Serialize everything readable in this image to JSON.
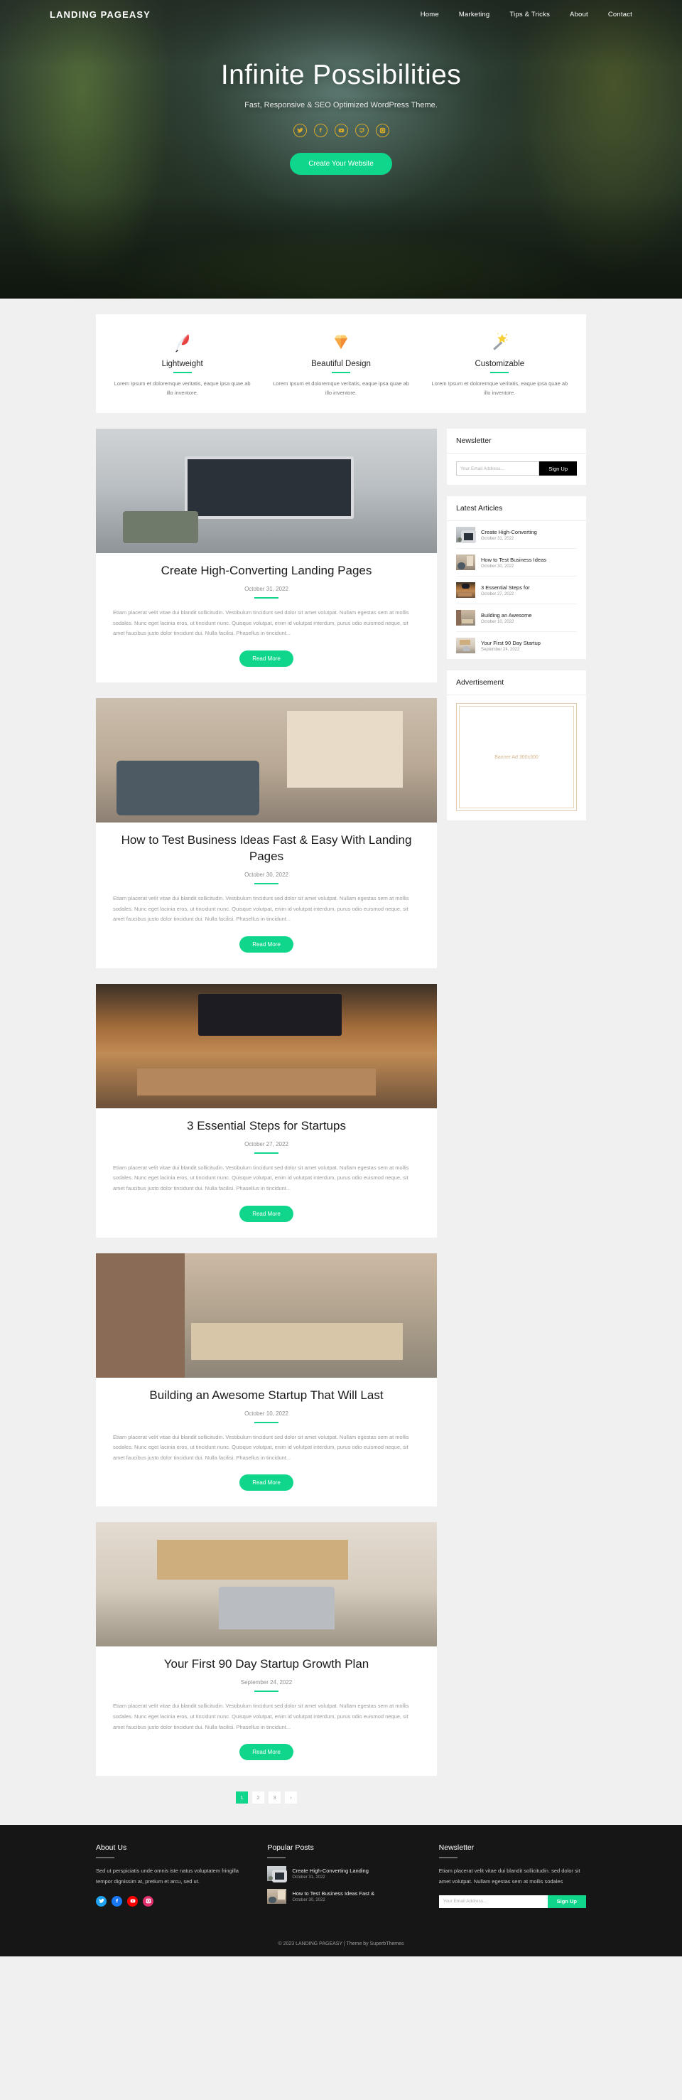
{
  "hero": {
    "brand": "LANDING PAGEASY",
    "nav": [
      {
        "label": "Home"
      },
      {
        "label": "Marketing"
      },
      {
        "label": "Tips & Tricks"
      },
      {
        "label": "About"
      },
      {
        "label": "Contact"
      }
    ],
    "title": "Infinite Possibilities",
    "subtitle": "Fast, Responsive & SEO Optimized WordPress Theme.",
    "social": [
      {
        "name": "twitter-icon"
      },
      {
        "name": "facebook-icon"
      },
      {
        "name": "youtube-icon"
      },
      {
        "name": "twitch-icon"
      },
      {
        "name": "instagram-icon"
      }
    ],
    "cta_label": "Create Your Website",
    "accent_color": "#0fd68a",
    "social_ring_color": "#d9a92a"
  },
  "features": [
    {
      "icon": "feather-icon",
      "title": "Lightweight",
      "text": "Lorem Ipsum et doloremque veritatis, eaque ipsa quae ab illo inventore."
    },
    {
      "icon": "diamond-icon",
      "title": "Beautiful Design",
      "text": "Lorem Ipsum et doloremque veritatis, eaque ipsa quae ab illo inventore."
    },
    {
      "icon": "magic-wand-icon",
      "title": "Customizable",
      "text": "Lorem Ipsum et doloremque veritatis, eaque ipsa quae ab illo inventore."
    }
  ],
  "posts": [
    {
      "title": "Create High-Converting Landing Pages",
      "date": "October 31, 2022",
      "excerpt": "Etiam placerat velit vitae dui blandit sollicitudin. Vestibulum tincidunt sed dolor sit amet volutpat. Nullam egestas sem at mollis sodales. Nunc eget lacinia eros, ut tincidunt nunc. Quisque volutpat, enim id volutpat interdum, purus odio euismod neque, sit amet faucibus justo dolor tincidunt dui. Nulla facilisi. Phasellus in tincidunt...",
      "read_more": "Read More",
      "thumb_class": "t1"
    },
    {
      "title": "How to Test Business Ideas Fast & Easy With Landing Pages",
      "date": "October 30, 2022",
      "excerpt": "Etiam placerat velit vitae dui blandit sollicitudin. Vestibulum tincidunt sed dolor sit amet volutpat. Nullam egestas sem at mollis sodales. Nunc eget lacinia eros, ut tincidunt nunc. Quisque volutpat, enim id volutpat interdum, purus odio euismod neque, sit amet faucibus justo dolor tincidunt dui. Nulla facilisi. Phasellus in tincidunt...",
      "read_more": "Read More",
      "thumb_class": "t2"
    },
    {
      "title": "3 Essential Steps for Startups",
      "date": "October 27, 2022",
      "excerpt": "Etiam placerat velit vitae dui blandit sollicitudin. Vestibulum tincidunt sed dolor sit amet volutpat. Nullam egestas sem at mollis sodales. Nunc eget lacinia eros, ut tincidunt nunc. Quisque volutpat, enim id volutpat interdum, purus odio euismod neque, sit amet faucibus justo dolor tincidunt dui. Nulla facilisi. Phasellus in tincidunt...",
      "read_more": "Read More",
      "thumb_class": "t3"
    },
    {
      "title": "Building an Awesome Startup That Will Last",
      "date": "October 10, 2022",
      "excerpt": "Etiam placerat velit vitae dui blandit sollicitudin. Vestibulum tincidunt sed dolor sit amet volutpat. Nullam egestas sem at mollis sodales. Nunc eget lacinia eros, ut tincidunt nunc. Quisque volutpat, enim id volutpat interdum, purus odio euismod neque, sit amet faucibus justo dolor tincidunt dui. Nulla facilisi. Phasellus in tincidunt...",
      "read_more": "Read More",
      "thumb_class": "t4"
    },
    {
      "title": "Your First 90 Day Startup Growth Plan",
      "date": "September 24, 2022",
      "excerpt": "Etiam placerat velit vitae dui blandit sollicitudin. Vestibulum tincidunt sed dolor sit amet volutpat. Nullam egestas sem at mollis sodales. Nunc eget lacinia eros, ut tincidunt nunc. Quisque volutpat, enim id volutpat interdum, purus odio euismod neque, sit amet faucibus justo dolor tincidunt dui. Nulla facilisi. Phasellus in tincidunt...",
      "read_more": "Read More",
      "thumb_class": "t5"
    }
  ],
  "sidebar": {
    "newsletter": {
      "heading": "Newsletter",
      "placeholder": "Your Email Address...",
      "button_label": "Sign Up"
    },
    "latest_articles": {
      "heading": "Latest Articles",
      "items": [
        {
          "title": "Create High-Converting",
          "date": "October 31, 2022",
          "thumb_class": "t1"
        },
        {
          "title": "How to Test Business Ideas",
          "date": "October 30, 2022",
          "thumb_class": "t2"
        },
        {
          "title": "3 Essential Steps for",
          "date": "October 27, 2022",
          "thumb_class": "t3"
        },
        {
          "title": "Building an Awesome",
          "date": "October 10, 2022",
          "thumb_class": "t4"
        },
        {
          "title": "Your First 90 Day Startup",
          "date": "September 24, 2022",
          "thumb_class": "t5"
        }
      ]
    },
    "advertisement": {
      "heading": "Advertisement",
      "banner_label": "Banner Ad 300x300"
    }
  },
  "pagination": {
    "pages": [
      "1",
      "2",
      "3",
      "›"
    ],
    "active_index": 0
  },
  "footer": {
    "about": {
      "heading": "About Us",
      "text": "Sed ut perspiciatis unde omnis iste natus voluptatem fringilla tempor dignissim at, pretium et arcu, sed ut.",
      "social": [
        {
          "name": "twitter-icon",
          "color": "#1da1f2"
        },
        {
          "name": "facebook-icon",
          "color": "#1877f2"
        },
        {
          "name": "youtube-icon",
          "color": "#ff0000"
        },
        {
          "name": "instagram-icon",
          "color": "#e1306c"
        }
      ]
    },
    "popular_posts": {
      "heading": "Popular Posts",
      "items": [
        {
          "title": "Create High-Converting Landing",
          "date": "October 31, 2022",
          "thumb_class": "t1"
        },
        {
          "title": "How to Test Business Ideas Fast &",
          "date": "October 30, 2022",
          "thumb_class": "t2"
        }
      ]
    },
    "newsletter": {
      "heading": "Newsletter",
      "text": "Etiam placerat velit vitae dui blandit sollicitudin. sed dolor sit amet volutpat. Nullam egestas sem at mollis sodales",
      "placeholder": "Your Email Address...",
      "button_label": "Sign Up"
    },
    "copyright": "© 2023 LANDING PAGEASY | Theme by SuperbThemes"
  }
}
